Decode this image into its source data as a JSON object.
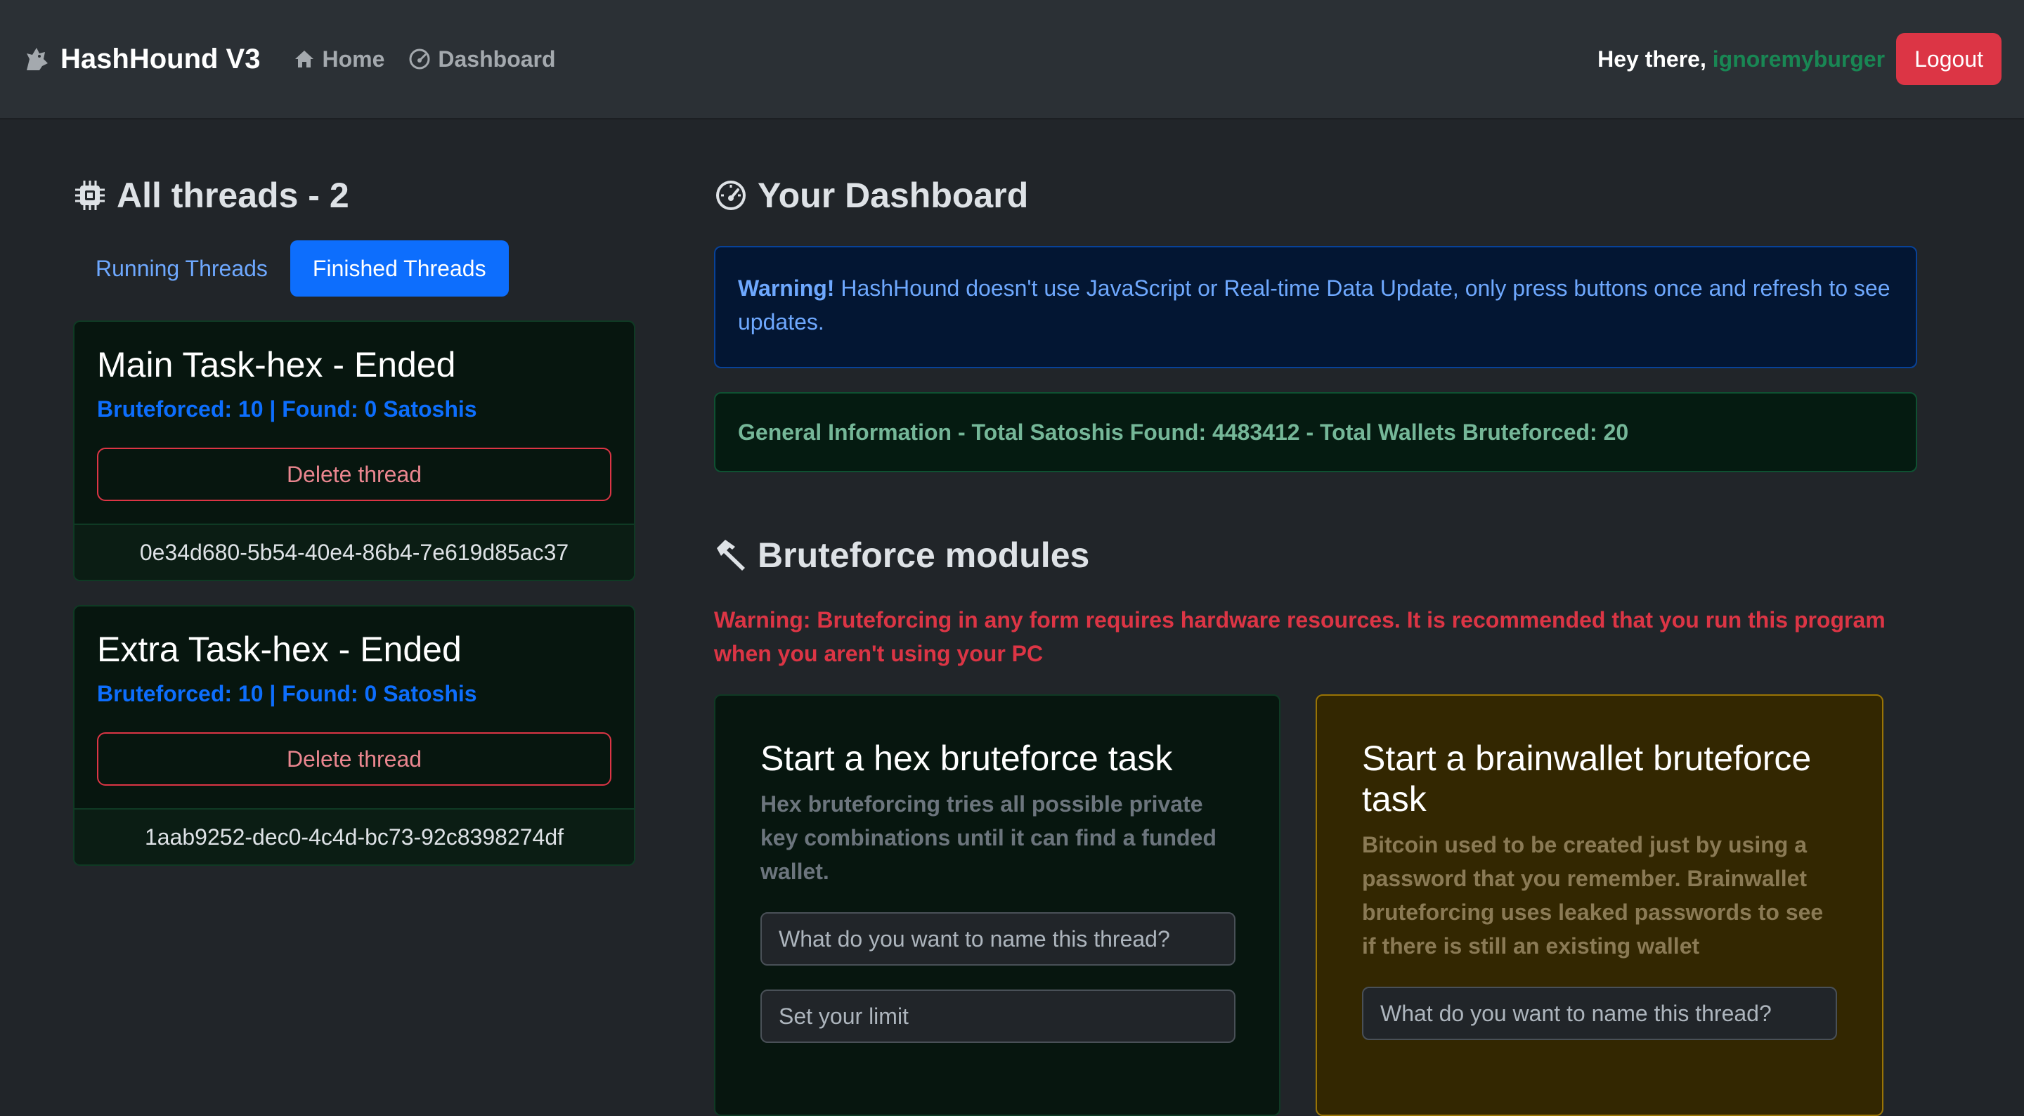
{
  "navbar": {
    "brand": "HashHound V3",
    "links": [
      {
        "label": "Home",
        "icon": "home-icon"
      },
      {
        "label": "Dashboard",
        "icon": "speedometer-icon"
      }
    ],
    "greeting": "Hey there,",
    "username": "ignoremyburger",
    "logout_label": "Logout"
  },
  "threads": {
    "title": "All threads - 2",
    "tabs": [
      {
        "label": "Running Threads",
        "active": false
      },
      {
        "label": "Finished Threads",
        "active": true
      }
    ],
    "items": [
      {
        "title": "Main Task-hex - Ended",
        "stats": "Bruteforced: 10 | Found: 0 Satoshis",
        "delete_label": "Delete thread",
        "id": "0e34d680-5b54-40e4-86b4-7e619d85ac37"
      },
      {
        "title": "Extra Task-hex - Ended",
        "stats": "Bruteforced: 10 | Found: 0 Satoshis",
        "delete_label": "Delete thread",
        "id": "1aab9252-dec0-4c4d-bc73-92c8398274df"
      }
    ]
  },
  "dashboard": {
    "title": "Your Dashboard",
    "warning_strong": "Warning!",
    "warning_text": "HashHound doesn't use JavaScript or Real-time Data Update, only press buttons once and refresh to see updates.",
    "general_info": "General Information - Total Satoshis Found: 4483412 - Total Wallets Bruteforced: 20"
  },
  "modules": {
    "title": "Bruteforce modules",
    "warning": "Warning: Bruteforcing in any form requires hardware resources. It is recommended that you run this program when you aren't using your PC",
    "hex": {
      "title": "Start a hex bruteforce task",
      "description": "Hex bruteforcing tries all possible private key combinations until it can find a funded wallet.",
      "name_placeholder": "What do you want to name this thread?",
      "limit_placeholder": "Set your limit"
    },
    "brain": {
      "title": "Start a brainwallet bruteforce task",
      "description": "Bitcoin used to be created just by using a password that you remember. Brainwallet bruteforcing uses leaked passwords to see if there is still an existing wallet",
      "name_placeholder": "What do you want to name this thread?"
    }
  },
  "colors": {
    "primary": "#0d6efd",
    "danger": "#dc3545",
    "success": "#198754",
    "background": "#212529"
  }
}
